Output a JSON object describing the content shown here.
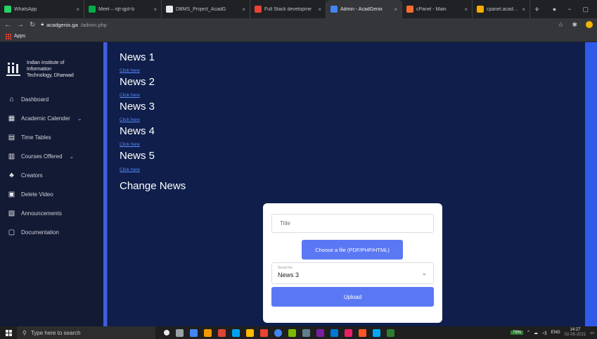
{
  "browser": {
    "tabs": [
      {
        "title": "WhatsApp",
        "icon_color": "#25d366",
        "active": false
      },
      {
        "title": "Meet – rqt-qjsf-b",
        "icon_color": "#00ac47",
        "active": false
      },
      {
        "title": "DBMS_Project_AcadG",
        "icon_color": "#e8eaed",
        "active": false
      },
      {
        "title": "Full Stack developme",
        "icon_color": "#ea4335",
        "active": false
      },
      {
        "title": "Admin - AcadGenix",
        "icon_color": "#4285f4",
        "active": true
      },
      {
        "title": "cPanel - Main",
        "icon_color": "#ff6c2c",
        "active": false
      },
      {
        "title": "cpanel.acadgenix.ga /",
        "icon_color": "#f9ab00",
        "active": false
      }
    ],
    "new_tab": "+",
    "url_host": "acadgenix.ga",
    "url_path": "/admin.php",
    "bookmarks_label": "Apps"
  },
  "sidebar": {
    "brand": [
      "Indian Institute of",
      "Information",
      "Technology, Dharwad"
    ],
    "items": [
      {
        "label": "Dashboard",
        "icon": "home-icon",
        "glyph": "⌂",
        "chevron": ""
      },
      {
        "label": "Academic Calender",
        "icon": "calendar-icon",
        "glyph": "▦",
        "chevron": "⌄"
      },
      {
        "label": "Time Tables",
        "icon": "timetable-icon",
        "glyph": "▤",
        "chevron": ""
      },
      {
        "label": "Courses Offered",
        "icon": "courses-icon",
        "glyph": "▥",
        "chevron": "⌄"
      },
      {
        "label": "Creators",
        "icon": "user-icon",
        "glyph": "♣",
        "chevron": ""
      },
      {
        "label": "Delete Video",
        "icon": "delete-video-icon",
        "glyph": "▣",
        "chevron": ""
      },
      {
        "label": "Announcements",
        "icon": "announcement-icon",
        "glyph": "▧",
        "chevron": ""
      },
      {
        "label": "Documentation",
        "icon": "document-icon",
        "glyph": "▢",
        "chevron": ""
      }
    ]
  },
  "main": {
    "news": [
      {
        "title": "News 1",
        "link": "Click here"
      },
      {
        "title": "News 2",
        "link": "Click here"
      },
      {
        "title": "News 3",
        "link": "Click here"
      },
      {
        "title": "News 4",
        "link": "Click here"
      },
      {
        "title": "News 5",
        "link": "Click here"
      }
    ],
    "change_news_heading": "Change News",
    "form": {
      "title_placeholder": "Title",
      "file_button": "Choose a file (PDF/PHP/HTML)",
      "select_label": "Serial No.",
      "select_value": "News 3",
      "upload_button": "Upload"
    }
  },
  "taskbar": {
    "search_placeholder": "Type here to search",
    "battery": "79%",
    "lang": "ENG",
    "time": "14:27",
    "date": "02-05-2021"
  }
}
